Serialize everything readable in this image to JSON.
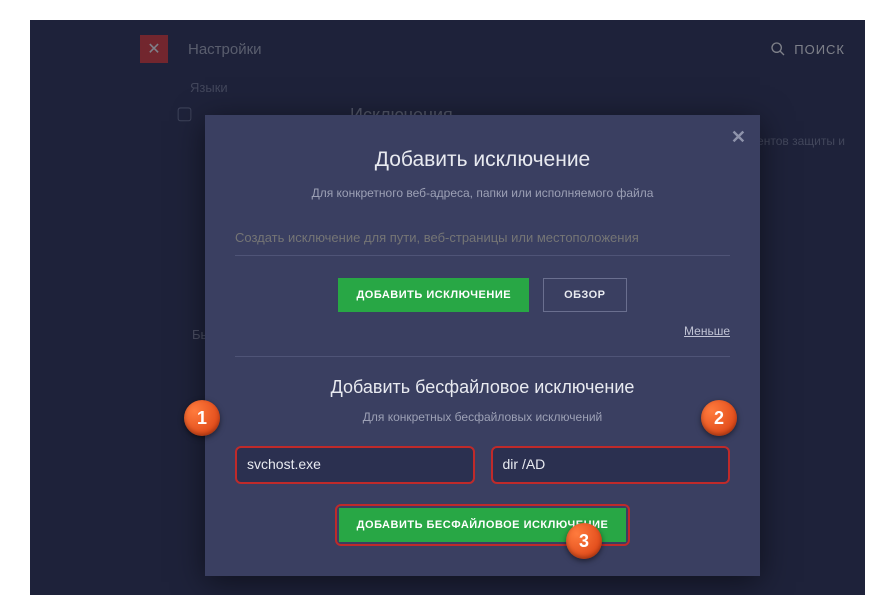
{
  "topbar": {
    "settings": "Настройки",
    "search": "ПОИСК"
  },
  "background": {
    "lang": "Языки",
    "heading": "Исключения",
    "text_fragment": "нентов защиты и",
    "quick": "Быстр"
  },
  "modal": {
    "title": "Добавить исключение",
    "subtitle": "Для конкретного веб-адреса, папки или исполняемого файла",
    "path_placeholder": "Создать исключение для пути, веб-страницы или местоположения",
    "add_btn": "ДОБАВИТЬ ИСКЛЮЧЕНИЕ",
    "browse_btn": "ОБЗОР",
    "less_link": "Меньше",
    "fileless_title": "Добавить бесфайловое исключение",
    "fileless_subtitle": "Для конкретных бесфайловых исключений",
    "input1_value": "svchost.exe",
    "input2_value": "dir /AD",
    "add_fileless_btn": "ДОБАВИТЬ БЕСФАЙЛОВОЕ ИСКЛЮЧЕНИЕ"
  },
  "markers": {
    "one": "1",
    "two": "2",
    "three": "3"
  }
}
